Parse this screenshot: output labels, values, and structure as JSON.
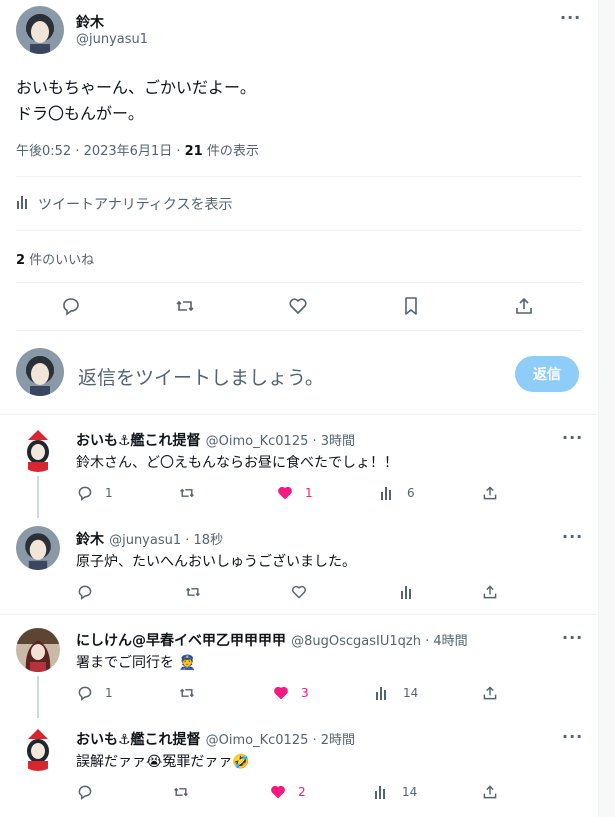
{
  "main": {
    "author": {
      "name": "鈴木",
      "handle": "@junyasu1"
    },
    "text_line1": "おいもちゃーん、ごかいだよー。",
    "text_line2": "ドラ〇もんがー。",
    "time": "午後0:52 · 2023年6月1日 · ",
    "views_count": "21",
    "views_label": " 件の表示",
    "analytics_label": "ツイートアナリティクスを表示",
    "likes_count": "2",
    "likes_label": " 件のいいね"
  },
  "composer": {
    "placeholder": "返信をツイートしましょう。",
    "button": "返信"
  },
  "replies": [
    {
      "name": "おいも⚓艦これ提督",
      "handle": "@Oimo_Kc0125 · 3時間",
      "text": "鈴木さん、ど〇えもんならお昼に食べたでしょ！！",
      "reply": "1",
      "retweet": "",
      "like": "1",
      "views": "6",
      "liked": true
    },
    {
      "name": "鈴木",
      "handle": "@junyasu1 · 18秒",
      "text": "原子炉、たいへんおいしゅうございました。",
      "reply": "",
      "retweet": "",
      "like": "",
      "views": "",
      "liked": false
    },
    {
      "name": "にしけん@早春イベ甲乙甲甲甲甲",
      "handle": "@8ugOscgasIU1qzh · 4時間",
      "text": "署までご同行を 👮",
      "reply": "1",
      "retweet": "",
      "like": "3",
      "views": "14",
      "liked": true
    },
    {
      "name": "おいも⚓艦これ提督",
      "handle": "@Oimo_Kc0125 · 2時間",
      "text": "誤解だァァ😭冤罪だァァ🤣",
      "reply": "",
      "retweet": "",
      "like": "2",
      "views": "14",
      "liked": true
    }
  ],
  "colors": {
    "accent": "#1d9bf0",
    "like": "#f91880",
    "button_disabled": "#8ecdf8"
  }
}
